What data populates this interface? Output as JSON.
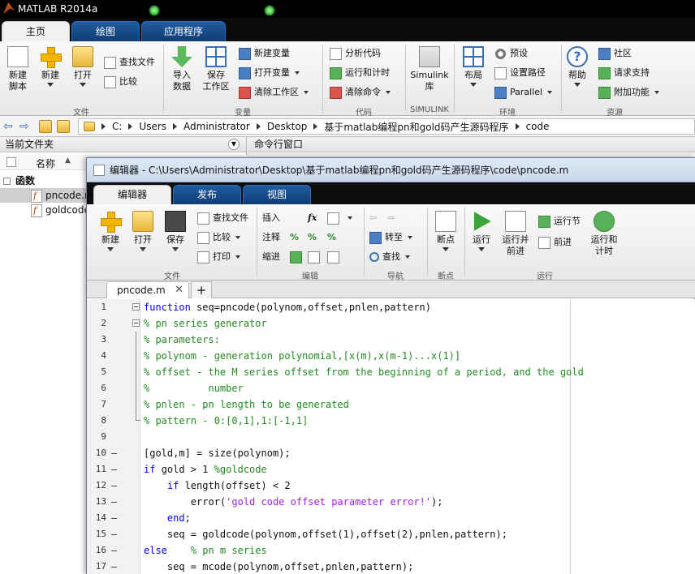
{
  "app": {
    "title": "MATLAB R2014a",
    "colors": {
      "accent": "#1f5ca0",
      "keyword": "#0000ff",
      "comment": "#228b22",
      "string": "#a020f0"
    }
  },
  "main_tabs": [
    "主页",
    "绘图",
    "应用程序"
  ],
  "ribbon": {
    "new_script": "新建\n脚本",
    "new": "新建",
    "open": "打开",
    "find_files": "查找文件",
    "compare": "比较",
    "group_file": "文件",
    "import_data": "导入\n数据",
    "save_workspace": "保存\n工作区",
    "new_variable": "新建变量",
    "open_variable": "打开变量",
    "clear_workspace": "清除工作区",
    "group_variable": "变量",
    "analyze_code": "分析代码",
    "run_and_time": "运行和计时",
    "clear_commands": "清除命令",
    "group_code": "代码",
    "simulink_library": "Simulink\n库",
    "group_simulink": "SIMULINK",
    "layout": "布局",
    "preferences": "预设",
    "set_path": "设置路径",
    "parallel": "Parallel",
    "group_environment": "环境",
    "help": "帮助",
    "community": "社区",
    "request_support": "请求支持",
    "add_ons": "附加功能",
    "group_resources": "资源"
  },
  "address": {
    "segments": [
      "C:",
      "Users",
      "Administrator",
      "Desktop",
      "基于matlab编程pn和gold码产生源码程序",
      "code"
    ]
  },
  "current_folder": {
    "title": "当前文件夹",
    "column_name": "名称",
    "sort_indicator": "▲",
    "group_label": "函数",
    "files": [
      "pncode.m",
      "goldcode.m"
    ]
  },
  "command_window": {
    "title": "命令行窗口"
  },
  "editor": {
    "title": "编辑器 - C:\\Users\\Administrator\\Desktop\\基于matlab编程pn和gold码产生源码程序\\code\\pncode.m",
    "tabs": [
      "编辑器",
      "发布",
      "视图"
    ],
    "ribbon": {
      "new": "新建",
      "open": "打开",
      "save": "保存",
      "find_files": "查找文件",
      "compare": "比较",
      "print": "打印",
      "group_file": "文件",
      "insert": "插入",
      "comment": "注释",
      "indent": "缩进",
      "fx": "fx",
      "group_edit": "编辑",
      "goto": "转至",
      "find": "查找",
      "group_navigate": "导航",
      "breakpoints": "断点",
      "group_breakpoints": "断点",
      "run": "运行",
      "run_and_advance": "运行并\n前进",
      "run_section": "运行节",
      "advance": "前进",
      "run_and_time": "运行和\n计时",
      "group_run": "运行"
    },
    "document_tab": "pncode.m",
    "close_glyph": "✕",
    "add_tab": "+",
    "code_lines": [
      {
        "n": "1",
        "mark": "",
        "fold": "open",
        "parts": [
          [
            "kw",
            "function"
          ],
          [
            "",
            " seq=pncode(polynom,offset,pnlen,pattern)"
          ]
        ]
      },
      {
        "n": "2",
        "mark": "",
        "fold": "open",
        "parts": [
          [
            "cm",
            "% pn series generator"
          ]
        ]
      },
      {
        "n": "3",
        "mark": "",
        "fold": "line",
        "parts": [
          [
            "cm",
            "% parameters:"
          ]
        ]
      },
      {
        "n": "4",
        "mark": "",
        "fold": "line",
        "parts": [
          [
            "cm",
            "% polynom - generation polynomial,[x(m),x(m-1)...x(1)]"
          ]
        ]
      },
      {
        "n": "5",
        "mark": "",
        "fold": "line",
        "parts": [
          [
            "cm",
            "% offset - the M series offset from the beginning of a period, and the gold"
          ]
        ]
      },
      {
        "n": "6",
        "mark": "",
        "fold": "line",
        "parts": [
          [
            "cm",
            "%          number"
          ]
        ]
      },
      {
        "n": "7",
        "mark": "",
        "fold": "line",
        "parts": [
          [
            "cm",
            "% pnlen - pn length to be generated"
          ]
        ]
      },
      {
        "n": "8",
        "mark": "",
        "fold": "end",
        "parts": [
          [
            "cm",
            "% pattern - 0:[0,1],1:[-1,1]"
          ]
        ]
      },
      {
        "n": "9",
        "mark": "",
        "fold": "",
        "parts": []
      },
      {
        "n": "10",
        "mark": "–",
        "fold": "",
        "parts": [
          [
            "",
            "[gold,m] = size(polynom);"
          ]
        ]
      },
      {
        "n": "11",
        "mark": "–",
        "fold": "",
        "parts": [
          [
            "kw",
            "if"
          ],
          [
            "",
            " gold > 1 "
          ],
          [
            "cm",
            "%goldcode"
          ]
        ]
      },
      {
        "n": "12",
        "mark": "–",
        "fold": "",
        "parts": [
          [
            "",
            "    "
          ],
          [
            "kw",
            "if"
          ],
          [
            "",
            " length(offset) < 2"
          ]
        ]
      },
      {
        "n": "13",
        "mark": "–",
        "fold": "",
        "parts": [
          [
            "",
            "        error("
          ],
          [
            "st",
            "'gold code offset parameter error!'"
          ],
          [
            "",
            ");"
          ]
        ]
      },
      {
        "n": "14",
        "mark": "–",
        "fold": "",
        "parts": [
          [
            "",
            "    "
          ],
          [
            "kw",
            "end"
          ],
          [
            "",
            ";"
          ]
        ]
      },
      {
        "n": "15",
        "mark": "–",
        "fold": "",
        "parts": [
          [
            "",
            "    seq = goldcode(polynom,offset(1),offset(2),pnlen,pattern);"
          ]
        ]
      },
      {
        "n": "16",
        "mark": "–",
        "fold": "",
        "parts": [
          [
            "kw",
            "else"
          ],
          [
            "",
            "    "
          ],
          [
            "cm",
            "% pn m series"
          ]
        ]
      },
      {
        "n": "17",
        "mark": "–",
        "fold": "",
        "parts": [
          [
            "",
            "    seq = mcode(polynom,offset,pnlen,pattern);"
          ]
        ]
      }
    ]
  }
}
